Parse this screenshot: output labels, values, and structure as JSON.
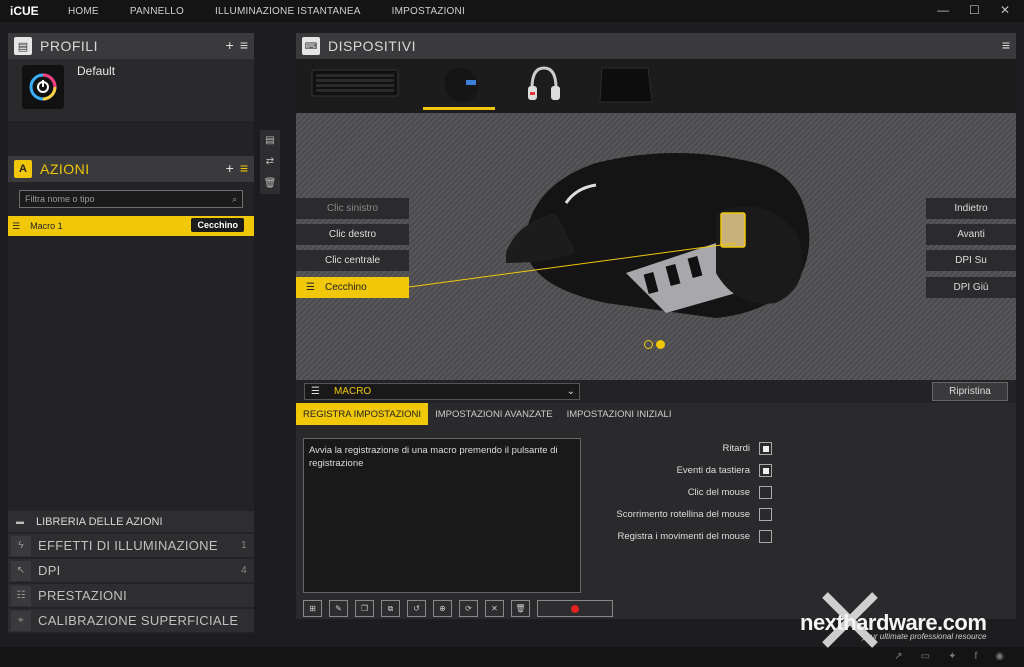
{
  "app": {
    "name": "iCUE"
  },
  "top_nav": [
    "HOME",
    "PANNELLO",
    "ILLUMINAZIONE ISTANTANEA",
    "IMPOSTAZIONI"
  ],
  "window_controls": [
    "—",
    "☐",
    "✕"
  ],
  "profiles": {
    "title": "PROFILI",
    "profile_name": "Default"
  },
  "actions": {
    "title": "AZIONI",
    "filter_placeholder": "Filtra nome o tipo",
    "macro_name": "Macro 1",
    "macro_badge": "Cecchino"
  },
  "library": {
    "label": "LIBRERIA DELLE AZIONI"
  },
  "accordion": [
    {
      "label": "EFFETTI DI ILLUMINAZIONE",
      "count": "1"
    },
    {
      "label": "DPI",
      "count": "4"
    },
    {
      "label": "PRESTAZIONI",
      "count": ""
    },
    {
      "label": "CALIBRAZIONE SUPERFICIALE",
      "count": ""
    }
  ],
  "devices": {
    "title": "DISPOSITIVI"
  },
  "buttons_left": [
    "Clic sinistro",
    "Clic destro",
    "Clic centrale",
    "Cecchino"
  ],
  "buttons_right": [
    "Indietro",
    "Avanti",
    "DPI Su",
    "DPI Giù"
  ],
  "macro_bar": {
    "select_value": "MACRO",
    "reset_label": "Ripristina"
  },
  "tabs": [
    "REGISTRA IMPOSTAZIONI",
    "IMPOSTAZIONI AVANZATE",
    "IMPOSTAZIONI INIZIALI"
  ],
  "record_hint": "Avvia la registrazione di una macro premendo il pulsante di registrazione",
  "options": [
    {
      "label": "Ritardi",
      "checked": true
    },
    {
      "label": "Eventi da tastiera",
      "checked": true
    },
    {
      "label": "Clic del mouse",
      "checked": false
    },
    {
      "label": "Scorrimento rotellina del mouse",
      "checked": false
    },
    {
      "label": "Registra i movimenti del mouse",
      "checked": false
    }
  ],
  "watermark": {
    "brand": "nexthardware.com",
    "tagline": "your ultimate professional resource"
  },
  "colors": {
    "accent": "#f0c808",
    "background": "#1d1d1f",
    "record": "#e32222"
  }
}
